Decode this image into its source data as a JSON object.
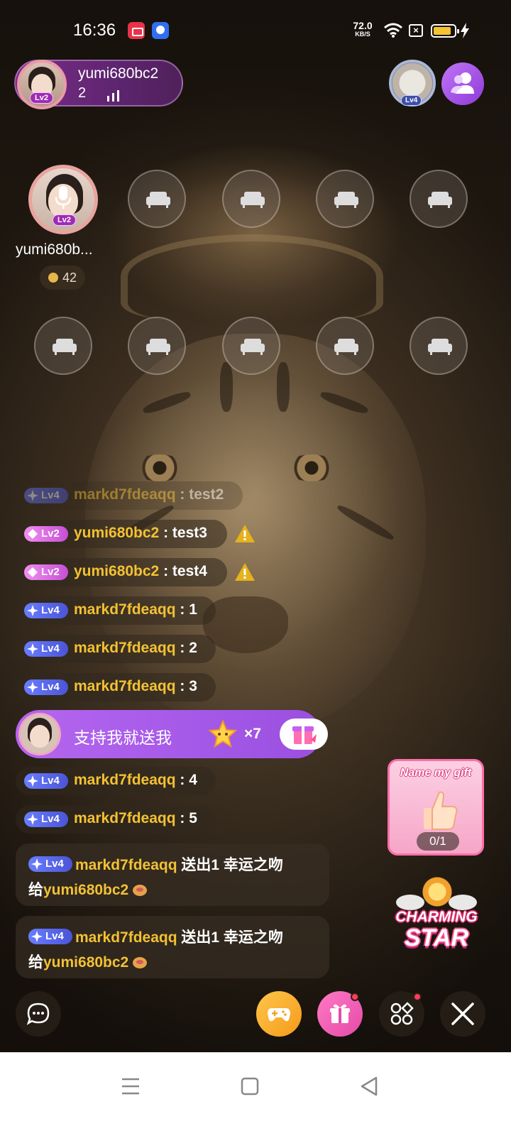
{
  "status_bar": {
    "time": "16:36",
    "net_speed_value": "72.0",
    "net_speed_unit": "KB/S",
    "icons": [
      "screen-recorder-icon",
      "baidu-app-icon",
      "wifi-icon",
      "no-sim-icon",
      "battery-icon",
      "charging-icon"
    ]
  },
  "host": {
    "name": "yumi680bc2",
    "viewer_count": "2",
    "level": "Lv2"
  },
  "top_right": {
    "badge_level": "Lv4"
  },
  "seats": {
    "host_seat": {
      "name": "yumi680b...",
      "level": "Lv2",
      "coins": "42"
    },
    "empty_seat_count": 9
  },
  "chat": {
    "messages": [
      {
        "level": "Lv4",
        "user": "markd7fdeaqq",
        "sep": " : ",
        "text": "test2",
        "warning": false,
        "faded": true
      },
      {
        "level": "Lv2",
        "user": "yumi680bc2",
        "sep": " : ",
        "text": "test3",
        "warning": true,
        "faded": false
      },
      {
        "level": "Lv2",
        "user": "yumi680bc2",
        "sep": " : ",
        "text": "test4",
        "warning": true,
        "faded": false
      },
      {
        "level": "Lv4",
        "user": "markd7fdeaqq",
        "sep": " : ",
        "text": "1",
        "warning": false,
        "faded": false
      },
      {
        "level": "Lv4",
        "user": "markd7fdeaqq",
        "sep": " : ",
        "text": "2",
        "warning": false,
        "faded": false
      },
      {
        "level": "Lv4",
        "user": "markd7fdeaqq",
        "sep": " : ",
        "text": "3",
        "warning": false,
        "faded": false
      },
      {
        "level": "Lv4",
        "user": "markd7fdeaqq",
        "sep": " : ",
        "text": "4",
        "warning": false,
        "faded": false
      },
      {
        "level": "Lv4",
        "user": "markd7fdeaqq",
        "sep": " : ",
        "text": "5",
        "warning": false,
        "faded": false
      }
    ],
    "promo": {
      "text": "支持我就送我",
      "multiplier": "×7"
    },
    "gift_messages": [
      {
        "level": "Lv4",
        "sender": "markd7fdeaqq",
        "action": " 送出1 幸运之吻",
        "to_prefix": "给",
        "recipient": "yumi680bc2"
      },
      {
        "level": "Lv4",
        "sender": "markd7fdeaqq",
        "action": " 送出1 幸运之吻",
        "to_prefix": "给",
        "recipient": "yumi680bc2"
      }
    ]
  },
  "side": {
    "name_gift_title": "Name my gift",
    "name_gift_progress": "0/1",
    "charming_line1": "CHARMING",
    "charming_line2": "STAR"
  },
  "toolbar": {
    "items": [
      "chat-icon",
      "game-controller-icon",
      "gift-icon",
      "more-apps-icon",
      "close-icon"
    ]
  }
}
